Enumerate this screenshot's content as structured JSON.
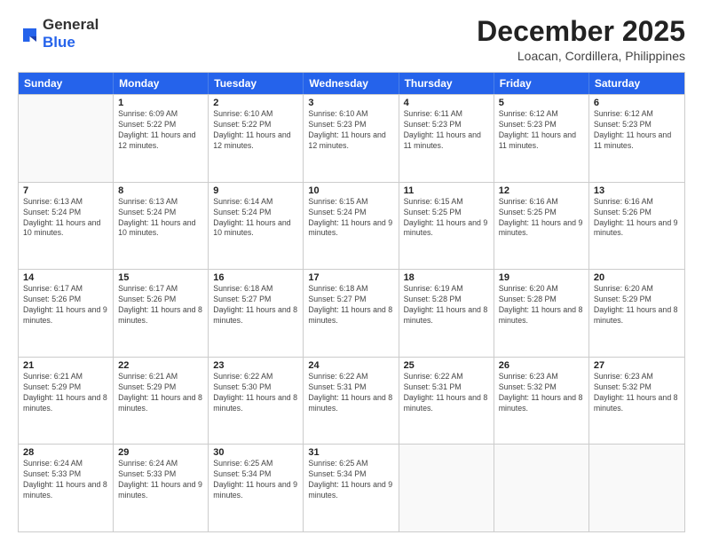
{
  "header": {
    "logo_general": "General",
    "logo_blue": "Blue",
    "month_year": "December 2025",
    "location": "Loacan, Cordillera, Philippines"
  },
  "days_of_week": [
    "Sunday",
    "Monday",
    "Tuesday",
    "Wednesday",
    "Thursday",
    "Friday",
    "Saturday"
  ],
  "rows": [
    [
      {
        "day": "",
        "empty": true
      },
      {
        "day": "1",
        "sunrise": "6:09 AM",
        "sunset": "5:22 PM",
        "daylight": "11 hours and 12 minutes."
      },
      {
        "day": "2",
        "sunrise": "6:10 AM",
        "sunset": "5:22 PM",
        "daylight": "11 hours and 12 minutes."
      },
      {
        "day": "3",
        "sunrise": "6:10 AM",
        "sunset": "5:23 PM",
        "daylight": "11 hours and 12 minutes."
      },
      {
        "day": "4",
        "sunrise": "6:11 AM",
        "sunset": "5:23 PM",
        "daylight": "11 hours and 11 minutes."
      },
      {
        "day": "5",
        "sunrise": "6:12 AM",
        "sunset": "5:23 PM",
        "daylight": "11 hours and 11 minutes."
      },
      {
        "day": "6",
        "sunrise": "6:12 AM",
        "sunset": "5:23 PM",
        "daylight": "11 hours and 11 minutes."
      }
    ],
    [
      {
        "day": "7",
        "sunrise": "6:13 AM",
        "sunset": "5:24 PM",
        "daylight": "11 hours and 10 minutes."
      },
      {
        "day": "8",
        "sunrise": "6:13 AM",
        "sunset": "5:24 PM",
        "daylight": "11 hours and 10 minutes."
      },
      {
        "day": "9",
        "sunrise": "6:14 AM",
        "sunset": "5:24 PM",
        "daylight": "11 hours and 10 minutes."
      },
      {
        "day": "10",
        "sunrise": "6:15 AM",
        "sunset": "5:24 PM",
        "daylight": "11 hours and 9 minutes."
      },
      {
        "day": "11",
        "sunrise": "6:15 AM",
        "sunset": "5:25 PM",
        "daylight": "11 hours and 9 minutes."
      },
      {
        "day": "12",
        "sunrise": "6:16 AM",
        "sunset": "5:25 PM",
        "daylight": "11 hours and 9 minutes."
      },
      {
        "day": "13",
        "sunrise": "6:16 AM",
        "sunset": "5:26 PM",
        "daylight": "11 hours and 9 minutes."
      }
    ],
    [
      {
        "day": "14",
        "sunrise": "6:17 AM",
        "sunset": "5:26 PM",
        "daylight": "11 hours and 9 minutes."
      },
      {
        "day": "15",
        "sunrise": "6:17 AM",
        "sunset": "5:26 PM",
        "daylight": "11 hours and 8 minutes."
      },
      {
        "day": "16",
        "sunrise": "6:18 AM",
        "sunset": "5:27 PM",
        "daylight": "11 hours and 8 minutes."
      },
      {
        "day": "17",
        "sunrise": "6:18 AM",
        "sunset": "5:27 PM",
        "daylight": "11 hours and 8 minutes."
      },
      {
        "day": "18",
        "sunrise": "6:19 AM",
        "sunset": "5:28 PM",
        "daylight": "11 hours and 8 minutes."
      },
      {
        "day": "19",
        "sunrise": "6:20 AM",
        "sunset": "5:28 PM",
        "daylight": "11 hours and 8 minutes."
      },
      {
        "day": "20",
        "sunrise": "6:20 AM",
        "sunset": "5:29 PM",
        "daylight": "11 hours and 8 minutes."
      }
    ],
    [
      {
        "day": "21",
        "sunrise": "6:21 AM",
        "sunset": "5:29 PM",
        "daylight": "11 hours and 8 minutes."
      },
      {
        "day": "22",
        "sunrise": "6:21 AM",
        "sunset": "5:29 PM",
        "daylight": "11 hours and 8 minutes."
      },
      {
        "day": "23",
        "sunrise": "6:22 AM",
        "sunset": "5:30 PM",
        "daylight": "11 hours and 8 minutes."
      },
      {
        "day": "24",
        "sunrise": "6:22 AM",
        "sunset": "5:31 PM",
        "daylight": "11 hours and 8 minutes."
      },
      {
        "day": "25",
        "sunrise": "6:22 AM",
        "sunset": "5:31 PM",
        "daylight": "11 hours and 8 minutes."
      },
      {
        "day": "26",
        "sunrise": "6:23 AM",
        "sunset": "5:32 PM",
        "daylight": "11 hours and 8 minutes."
      },
      {
        "day": "27",
        "sunrise": "6:23 AM",
        "sunset": "5:32 PM",
        "daylight": "11 hours and 8 minutes."
      }
    ],
    [
      {
        "day": "28",
        "sunrise": "6:24 AM",
        "sunset": "5:33 PM",
        "daylight": "11 hours and 8 minutes."
      },
      {
        "day": "29",
        "sunrise": "6:24 AM",
        "sunset": "5:33 PM",
        "daylight": "11 hours and 9 minutes."
      },
      {
        "day": "30",
        "sunrise": "6:25 AM",
        "sunset": "5:34 PM",
        "daylight": "11 hours and 9 minutes."
      },
      {
        "day": "31",
        "sunrise": "6:25 AM",
        "sunset": "5:34 PM",
        "daylight": "11 hours and 9 minutes."
      },
      {
        "day": "",
        "empty": true
      },
      {
        "day": "",
        "empty": true
      },
      {
        "day": "",
        "empty": true
      }
    ]
  ]
}
